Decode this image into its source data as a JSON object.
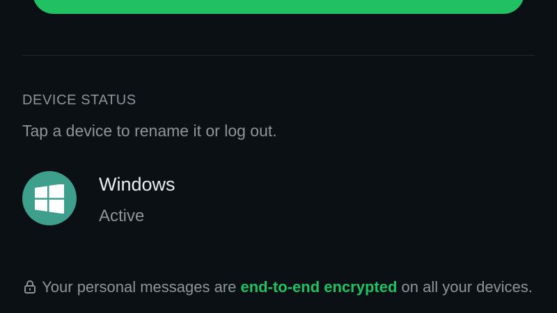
{
  "device_status": {
    "title": "DEVICE STATUS",
    "hint": "Tap a device to rename it or log out."
  },
  "devices": [
    {
      "name": "Windows",
      "status": "Active",
      "icon": "windows-icon",
      "avatar_color": "#3d9f8c"
    }
  ],
  "encryption": {
    "text_before": "Your personal messages are",
    "link": "end-to-end encrypted",
    "text_after": "on all your devices.",
    "icon": "lock-icon"
  },
  "colors": {
    "accent": "#21c063",
    "background": "#0b1014",
    "primary_text": "#e9edef",
    "secondary_text": "#8d9599"
  }
}
